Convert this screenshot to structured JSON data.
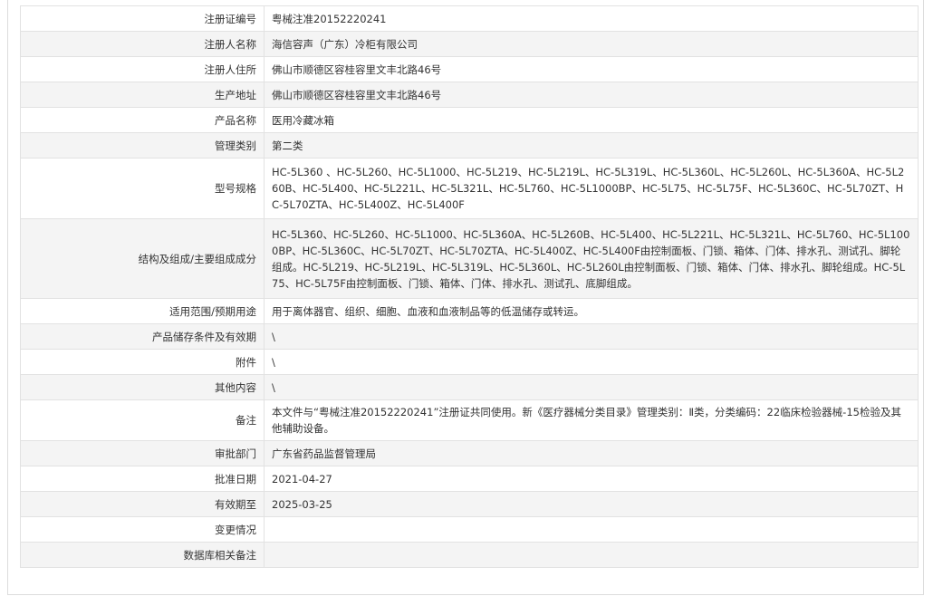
{
  "rows": [
    {
      "label": "注册证编号",
      "value": "粤械注准20152220241"
    },
    {
      "label": "注册人名称",
      "value": "海信容声（广东）冷柜有限公司"
    },
    {
      "label": "注册人住所",
      "value": "佛山市顺德区容桂容里文丰北路46号"
    },
    {
      "label": "生产地址",
      "value": "佛山市顺德区容桂容里文丰北路46号"
    },
    {
      "label": "产品名称",
      "value": "医用冷藏冰箱"
    },
    {
      "label": "管理类别",
      "value": "第二类"
    },
    {
      "label": "型号规格",
      "value": "HC-5L360 、HC-5L260、HC-5L1000、HC-5L219、HC-5L219L、HC-5L319L、HC-5L360L、HC-5L260L、HC-5L360A、HC-5L260B、HC-5L400、HC-5L221L、HC-5L321L、HC-5L760、HC-5L1000BP、HC-5L75、HC-5L75F、HC-5L360C、HC-5L70ZT、HC-5L70ZTA、HC-5L400Z、HC-5L400F"
    },
    {
      "label": "结构及组成/主要组成成分",
      "value": "HC-5L360、HC-5L260、HC-5L1000、HC-5L360A、HC-5L260B、HC-5L400、HC-5L221L、HC-5L321L、HC-5L760、HC-5L1000BP、HC-5L360C、HC-5L70ZT、HC-5L70ZTA、HC-5L400Z、HC-5L400F由控制面板、门锁、箱体、门体、排水孔、测试孔、脚轮组成。HC-5L219、HC-5L219L、HC-5L319L、HC-5L360L、HC-5L260L由控制面板、门锁、箱体、门体、排水孔、脚轮组成。HC-5L75、HC-5L75F由控制面板、门锁、箱体、门体、排水孔、测试孔、底脚组成。"
    },
    {
      "label": "适用范围/预期用途",
      "value": "用于离体器官、组织、细胞、血液和血液制品等的低温储存或转运。"
    },
    {
      "label": "产品储存条件及有效期",
      "value": "\\"
    },
    {
      "label": "附件",
      "value": "\\"
    },
    {
      "label": "其他内容",
      "value": "\\"
    },
    {
      "label": "备注",
      "value": "本文件与“粤械注准20152220241”注册证共同使用。新《医疗器械分类目录》管理类别：Ⅱ类，分类编码：22临床检验器械-15检验及其他辅助设备。"
    },
    {
      "label": "审批部门",
      "value": "广东省药品监督管理局"
    },
    {
      "label": "批准日期",
      "value": "2021-04-27"
    },
    {
      "label": "有效期至",
      "value": "2025-03-25"
    },
    {
      "label": "变更情况",
      "value": ""
    },
    {
      "label": "数据库相关备注",
      "value": ""
    }
  ]
}
